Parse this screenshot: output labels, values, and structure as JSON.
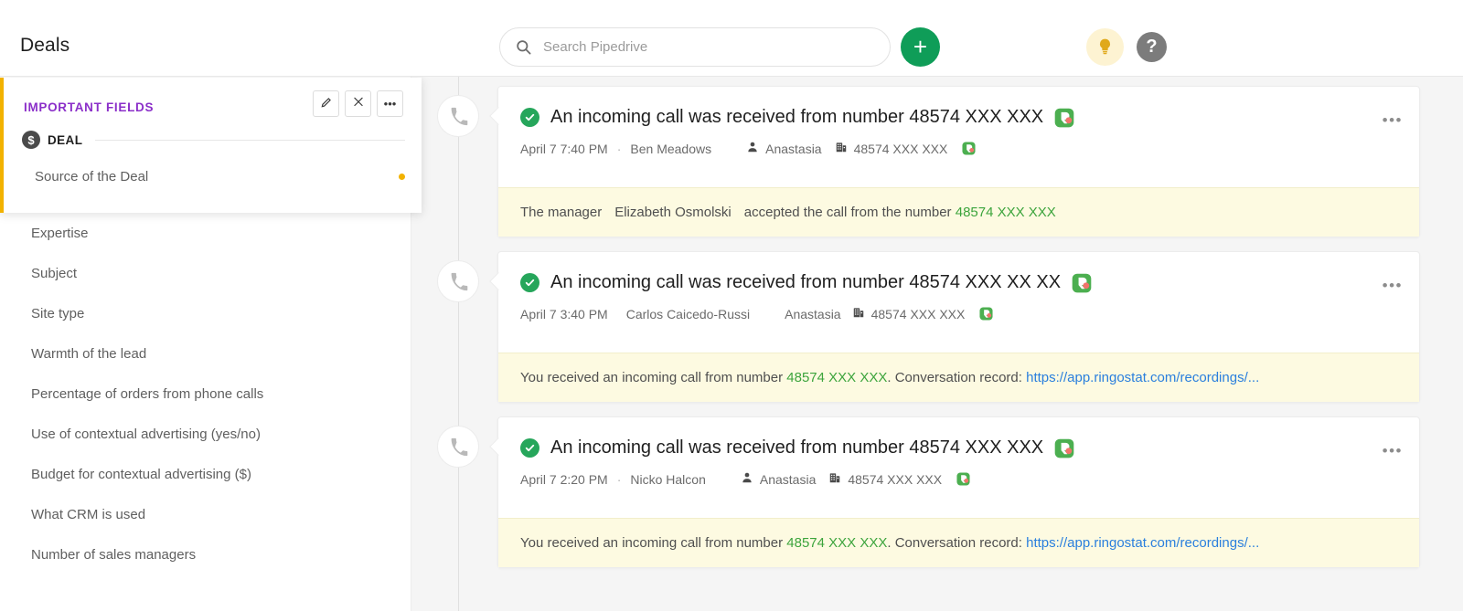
{
  "header": {
    "title": "Deals",
    "search": {
      "placeholder": "Search Pipedrive",
      "value": "",
      "icon": "search-icon"
    },
    "add_button_label": "+",
    "bulb_icon": "lightbulb-icon",
    "help_label": "?"
  },
  "important_fields_panel": {
    "title": "IMPORTANT FIELDS",
    "actions": [
      {
        "name": "edit-fields-button",
        "icon": "pencil-icon",
        "label": "✎"
      },
      {
        "name": "collapse-button",
        "icon": "collapse-icon",
        "label": "✕"
      },
      {
        "name": "more-options-button",
        "icon": "ellipsis-icon",
        "label": "•••"
      }
    ],
    "group": {
      "badge": "$",
      "label": "DEAL"
    },
    "highlighted_field": {
      "label": "Source of the Deal",
      "has_dot": true
    }
  },
  "sidebar": {
    "fields": [
      {
        "label": "Expertise"
      },
      {
        "label": "Subject"
      },
      {
        "label": "Site type"
      },
      {
        "label": "Warmth of the lead"
      },
      {
        "label": "Percentage of orders from phone calls"
      },
      {
        "label": "Use of contextual advertising (yes/no)"
      },
      {
        "label": "Budget for contextual advertising ($)"
      },
      {
        "label": "What CRM is used"
      },
      {
        "label": "Number of sales managers"
      }
    ]
  },
  "timeline": {
    "items": [
      {
        "bullet_icon": "phone-icon",
        "title": "An incoming call was received from number 48574 XXX XXX",
        "date": "April 7 7:40 PM",
        "separator": "·",
        "author": "Ben Meadows",
        "person": "Anastasia",
        "organization": "48574 XXX XXX",
        "source_icon": "ringostat-icon",
        "more_label": "•••",
        "note": {
          "prefix": "The manager",
          "manager": "Elizabeth Osmolski",
          "middle": "accepted the call from the number",
          "phone": "48574 XXX XXX",
          "suffix": "",
          "link": ""
        }
      },
      {
        "bullet_icon": "phone-icon",
        "title": "An incoming call was received from number 48574 XXX XX XX",
        "date": "April 7 3:40 PM",
        "separator": "",
        "author": "Carlos Caicedo-Russi",
        "person": "Anastasia",
        "organization": "48574 XXX XXX",
        "source_icon": "ringostat-icon",
        "more_label": "•••",
        "note": {
          "prefix": "You received an incoming call from number",
          "manager": "",
          "middle": "",
          "phone": "48574 XXX XXX",
          "suffix": ". Conversation record:",
          "link": "https://app.ringostat.com/recordings/..."
        }
      },
      {
        "bullet_icon": "phone-icon",
        "title": "An incoming call was received from number 48574 XXX XXX",
        "date": "April 7 2:20 PM",
        "separator": "·",
        "author": "Nicko Halcon",
        "person": "Anastasia",
        "organization": "48574 XXX XXX",
        "source_icon": "ringostat-icon",
        "more_label": "•••",
        "note": {
          "prefix": "You received an incoming call from number",
          "manager": "",
          "middle": "",
          "phone": "48574 XXX XXX",
          "suffix": ". Conversation record:",
          "link": "https://app.ringostat.com/recordings/..."
        }
      }
    ]
  },
  "colors": {
    "accent_purple": "#8b2fc9",
    "accent_yellow": "#f2b200",
    "green": "#0f9d58",
    "check_green": "#26a65b",
    "phone_green": "#3ca43c",
    "link_blue": "#2a7fdd",
    "note_bg": "#fdfae1"
  }
}
